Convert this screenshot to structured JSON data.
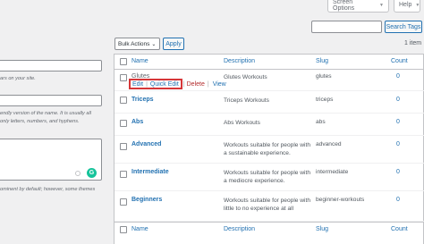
{
  "header": {
    "screen_options": "Screen Options",
    "help": "Help"
  },
  "search": {
    "button_label": "Search Tags",
    "value": ""
  },
  "bulk": {
    "select_value": "Bulk Actions",
    "apply_label": "Apply",
    "count": "1 item"
  },
  "form": {
    "help_name": "ars on your site.",
    "help_slug_1": "endly version of the name. It is usually all",
    "help_slug_2": "only letters, numbers, and hyphens.",
    "help_desc_1": "ominent by default; however, some themes",
    "help_desc_2": "",
    "grammarly_icon": "G"
  },
  "table": {
    "columns": [
      "Name",
      "Description",
      "Slug",
      "Count"
    ],
    "rows": [
      {
        "name": "Glutes",
        "description": "Glutes Workouts",
        "slug": "glutes",
        "count": "0"
      },
      {
        "name": "Triceps",
        "description": "Triceps Workouts",
        "slug": "triceps",
        "count": "0"
      },
      {
        "name": "Abs",
        "description": "Abs Workouts",
        "slug": "abs",
        "count": "0"
      },
      {
        "name": "Advanced",
        "description": "Workouts suitable for people with a sustainable experience.",
        "slug": "advanced",
        "count": "0"
      },
      {
        "name": "Intermediate",
        "description": "Workouts suitable for people with a mediocre experience.",
        "slug": "intermediate",
        "count": "0"
      },
      {
        "name": "Beginners",
        "description": "Workouts suitable for people with little to no experience at all",
        "slug": "beginner-workouts",
        "count": "0"
      }
    ],
    "row_actions": {
      "edit": "Edit",
      "quick_edit": "Quick Edit",
      "delete": "Delete",
      "view": "View"
    }
  },
  "colors": {
    "link": "#2271b1",
    "delete": "#b32d2e",
    "highlight": "#d63638"
  }
}
